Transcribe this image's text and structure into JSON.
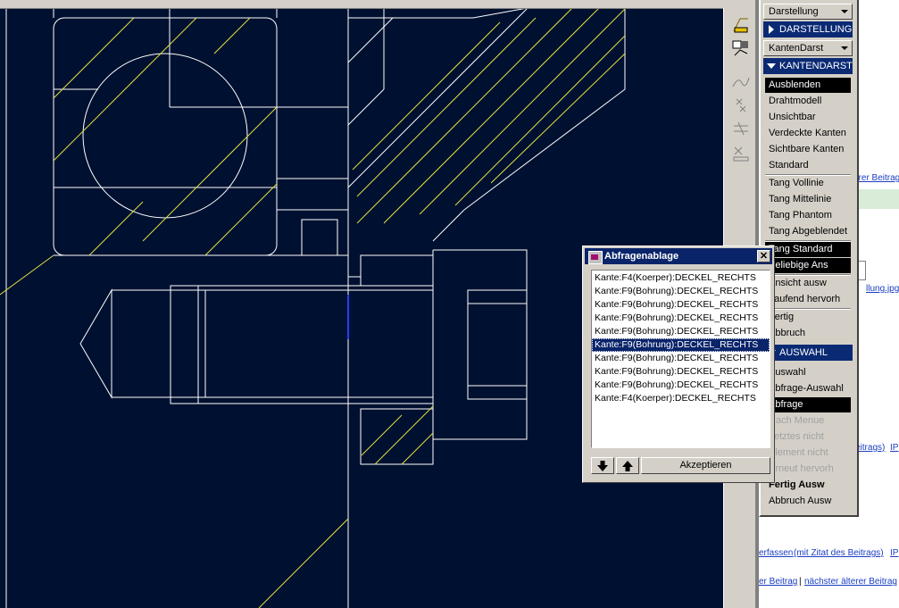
{
  "menu": {
    "drop1": "Darstellung",
    "header1": "DARSTELLUNG",
    "drop2": "KantenDarst",
    "header2": "KANTENDARST",
    "items": [
      {
        "label": "Ausblenden",
        "state": "selected"
      },
      {
        "label": "Drahtmodell",
        "state": "normal"
      },
      {
        "label": "Unsichtbar",
        "state": "normal"
      },
      {
        "label": "Verdeckte Kanten",
        "state": "normal"
      },
      {
        "label": "Sichtbare Kanten",
        "state": "normal"
      },
      {
        "label": "Standard",
        "state": "normal"
      },
      {
        "label": "Tang Vollinie",
        "state": "normal"
      },
      {
        "label": "Tang Mittelinie",
        "state": "normal"
      },
      {
        "label": "Tang Phantom",
        "state": "normal"
      },
      {
        "label": "Tang Abgeblendet",
        "state": "normal"
      },
      {
        "label": "Tang Standard",
        "state": "selected"
      },
      {
        "label": "Beliebige Ans",
        "state": "selected"
      },
      {
        "label": "Ansicht ausw",
        "state": "normal"
      },
      {
        "label": "Laufend hervorh",
        "state": "normal"
      },
      {
        "label": "Fertig",
        "state": "normal"
      },
      {
        "label": "Abbruch",
        "state": "normal"
      }
    ],
    "header3": "AUSWAHL",
    "items2": [
      {
        "label": "Auswahl",
        "state": "normal"
      },
      {
        "label": "Abfrage-Auswahl",
        "state": "normal"
      },
      {
        "label": "Abfrage",
        "state": "selected"
      },
      {
        "label": "Nach Menue",
        "state": "disabled"
      },
      {
        "label": "Letztes nicht",
        "state": "disabled"
      },
      {
        "label": "Element nicht",
        "state": "disabled"
      },
      {
        "label": "Erneut hervorh",
        "state": "disabled"
      },
      {
        "label": "Fertig Ausw",
        "state": "bold"
      },
      {
        "label": "Abbruch Ausw",
        "state": "normal"
      }
    ]
  },
  "dialog": {
    "title": "Abfragenablage",
    "close": "✕",
    "items": [
      "Kante:F4(Koerper):DECKEL_RECHTS",
      "Kante:F9(Bohrung):DECKEL_RECHTS",
      "Kante:F9(Bohrung):DECKEL_RECHTS",
      "Kante:F9(Bohrung):DECKEL_RECHTS",
      "Kante:F9(Bohrung):DECKEL_RECHTS",
      "Kante:F9(Bohrung):DECKEL_RECHTS",
      "Kante:F9(Bohrung):DECKEL_RECHTS",
      "Kante:F9(Bohrung):DECKEL_RECHTS",
      "Kante:F9(Bohrung):DECKEL_RECHTS",
      "Kante:F4(Koerper):DECKEL_RECHTS"
    ],
    "selected_index": 5,
    "accept": "Akzeptieren",
    "down_icon": "arrow-down-icon",
    "up_icon": "arrow-up-icon"
  },
  "webpage": {
    "link1": "erer Beitrag",
    "link2": "llung.jpg",
    "link3": "eitrags)",
    "link3b": "IP",
    "link4": "erfassen",
    "link5": "(mit Zitat des Beitrags)",
    "link5b": "IP",
    "link6": "er Beitrag",
    "sep": "|",
    "link7": "nächster älterer Beitrag"
  },
  "colors": {
    "canvas": "#001030",
    "lines": "#ffffff",
    "hatch": "#e0e040",
    "selection": "#0a246a"
  }
}
